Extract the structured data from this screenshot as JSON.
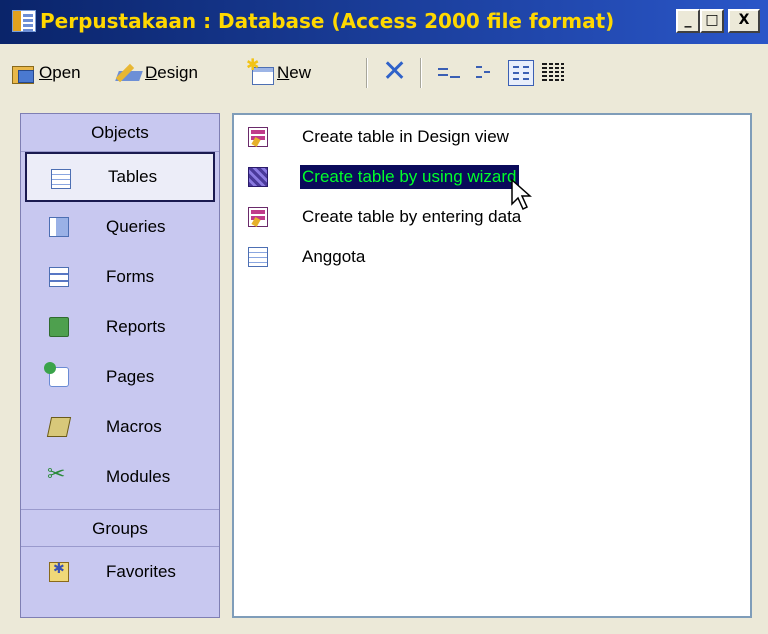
{
  "window": {
    "title": "Perpustakaan : Database (Access 2000 file format)",
    "controls": {
      "minimize": "_",
      "maximize": "□",
      "close": "X"
    }
  },
  "toolbar": {
    "open_label": "Open",
    "design_label": "Design",
    "new_label": "New",
    "open_underline": "O",
    "design_underline": "D",
    "new_underline": "N",
    "icons": [
      "open-icon",
      "design-icon",
      "new-icon",
      "delete-icon",
      "large-icons-view-icon",
      "small-icons-view-icon",
      "list-view-icon",
      "details-view-icon"
    ],
    "active_view": "list"
  },
  "objects_bar": {
    "header": "Objects",
    "items": [
      {
        "label": "Tables",
        "icon": "table-icon",
        "selected": true
      },
      {
        "label": "Queries",
        "icon": "query-icon"
      },
      {
        "label": "Forms",
        "icon": "form-icon"
      },
      {
        "label": "Reports",
        "icon": "report-icon"
      },
      {
        "label": "Pages",
        "icon": "page-icon"
      },
      {
        "label": "Macros",
        "icon": "macro-icon"
      },
      {
        "label": "Modules",
        "icon": "module-icon"
      }
    ],
    "groups_header": "Groups",
    "groups": [
      {
        "label": "Favorites",
        "icon": "favorites-icon"
      }
    ]
  },
  "content": {
    "items": [
      {
        "label": "Create table in Design view",
        "icon": "design-view-icon"
      },
      {
        "label": "Create table by using wizard",
        "icon": "wizard-icon",
        "selected": true
      },
      {
        "label": "Create table by entering data",
        "icon": "datasheet-icon"
      },
      {
        "label": "Anggota",
        "icon": "table-icon"
      }
    ]
  },
  "colors": {
    "title_bar": "#0a246a",
    "title_text": "#ffd800",
    "objects_bar": "#c8c8f0",
    "selection_bg": "#0a0a5a",
    "selection_text": "#00ff2a"
  }
}
